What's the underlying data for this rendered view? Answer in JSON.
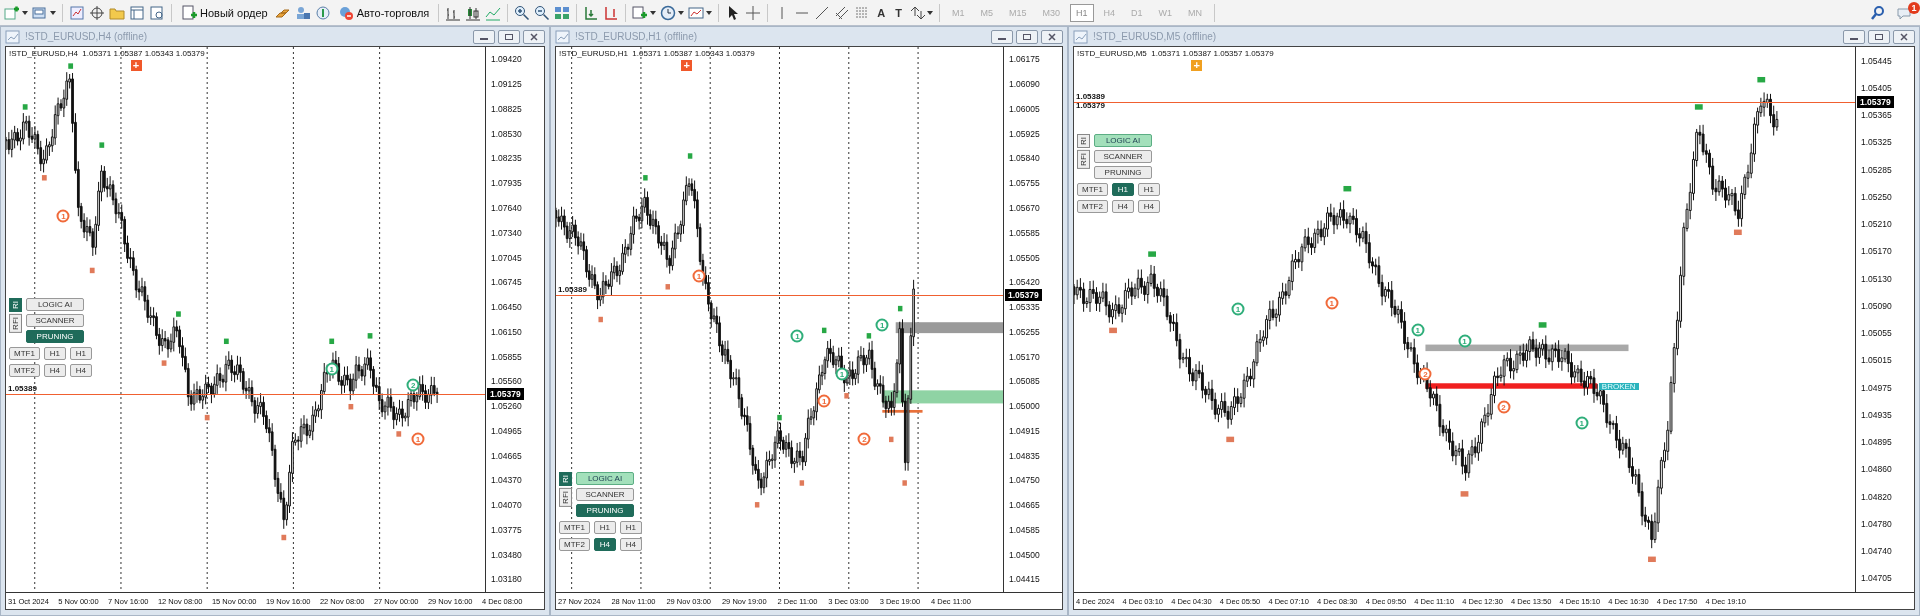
{
  "toolbar": {
    "new_order": "Новый ордер",
    "auto_trading": "Авто-торговля",
    "text_tool": "A",
    "label_tool": "T",
    "timeframes": [
      {
        "label": "M1",
        "selected": false
      },
      {
        "label": "M5",
        "selected": false
      },
      {
        "label": "M15",
        "selected": false
      },
      {
        "label": "M30",
        "selected": false
      },
      {
        "label": "H1",
        "selected": true
      },
      {
        "label": "H4",
        "selected": false
      },
      {
        "label": "D1",
        "selected": false
      },
      {
        "label": "W1",
        "selected": false
      },
      {
        "label": "MN",
        "selected": false
      }
    ],
    "notification_badge": "1"
  },
  "charts": [
    {
      "title": "!STD_EURUSD,H4 (offline)",
      "info": "!STD_EURUSD,H4  1.05371 1.05387 1.05343 1.05379",
      "plus": "+",
      "yticks": [
        "1.09420",
        "1.09125",
        "1.08825",
        "1.08530",
        "1.08235",
        "1.07935",
        "1.07640",
        "1.07340",
        "1.07045",
        "1.06745",
        "1.06450",
        "1.06150",
        "1.05855",
        "1.05560",
        "1.05260",
        "1.04965",
        "1.04665",
        "1.04370",
        "1.04070",
        "1.03775",
        "1.03480",
        "1.03180"
      ],
      "xticks": [
        "31 Oct 2024",
        "5 Nov 00:00",
        "7 Nov 16:00",
        "12 Nov 08:00",
        "15 Nov 00:00",
        "19 Nov 16:00",
        "22 Nov 08:00",
        "27 Nov 00:00",
        "29 Nov 16:00",
        "4 Dec 08:00"
      ],
      "price_tag": "1.05379",
      "line_labels": [
        "1.05389"
      ],
      "markers": [
        {
          "label": "1",
          "color": "#f06a3a"
        },
        {
          "label": "1",
          "color": "#2fae7a"
        },
        {
          "label": "2",
          "color": "#2fae7a"
        },
        {
          "label": "1",
          "color": "#f06a3a"
        }
      ],
      "indicator": {
        "tabs": [
          {
            "label": "RI",
            "selected": true
          },
          {
            "label": "RFI",
            "selected": false
          }
        ],
        "buttons": [
          {
            "label": "LOGIC AI",
            "selected": false,
            "highlighted": false
          },
          {
            "label": "SCANNER",
            "selected": false,
            "highlighted": false
          },
          {
            "label": "PRUNING",
            "selected": true,
            "highlighted": false
          }
        ],
        "mtf_rows": [
          {
            "buttons": [
              {
                "label": "MTF1",
                "selected": false
              },
              {
                "label": "H1",
                "selected": false
              },
              {
                "label": "H1",
                "selected": false
              }
            ]
          },
          {
            "buttons": [
              {
                "label": "MTF2",
                "selected": false
              },
              {
                "label": "H4",
                "selected": false
              },
              {
                "label": "H4",
                "selected": false
              }
            ]
          }
        ]
      }
    },
    {
      "title": "!STD_EURUSD,H1 (offline)",
      "info": "!STD_EURUSD,H1  1.05371 1.05387 1.05343 1.05379",
      "plus": "+",
      "yticks": [
        "1.06175",
        "1.06090",
        "1.06005",
        "1.05925",
        "1.05840",
        "1.05755",
        "1.05670",
        "1.05585",
        "1.05505",
        "1.05420",
        "1.05335",
        "1.05255",
        "1.05170",
        "1.05085",
        "1.05000",
        "1.04915",
        "1.04835",
        "1.04750",
        "1.04665",
        "1.04585",
        "1.04500",
        "1.04415"
      ],
      "xticks": [
        "27 Nov 2024",
        "28 Nov 11:00",
        "29 Nov 03:00",
        "29 Nov 19:00",
        "2 Dec 11:00",
        "3 Dec 03:00",
        "3 Dec 19:00",
        "4 Dec 11:00"
      ],
      "price_tag": "1.05379",
      "line_labels": [
        "1.05389"
      ],
      "markers": [
        {
          "label": "1",
          "color": "#f06a3a"
        },
        {
          "label": "1",
          "color": "#2fae7a"
        },
        {
          "label": "1",
          "color": "#f06a3a"
        },
        {
          "label": "1",
          "color": "#2fae7a"
        },
        {
          "label": "1",
          "color": "#2fae7a"
        },
        {
          "label": "2",
          "color": "#f06a3a"
        }
      ],
      "indicator": {
        "tabs": [
          {
            "label": "RI",
            "selected": true
          },
          {
            "label": "RFI",
            "selected": false
          }
        ],
        "buttons": [
          {
            "label": "LOGIC AI",
            "selected": false,
            "highlighted": true
          },
          {
            "label": "SCANNER",
            "selected": false,
            "highlighted": false
          },
          {
            "label": "PRUNING",
            "selected": true,
            "highlighted": false
          }
        ],
        "mtf_rows": [
          {
            "buttons": [
              {
                "label": "MTF1",
                "selected": false
              },
              {
                "label": "H1",
                "selected": false
              },
              {
                "label": "H1",
                "selected": false
              }
            ]
          },
          {
            "buttons": [
              {
                "label": "MTF2",
                "selected": false
              },
              {
                "label": "H4",
                "selected": true
              },
              {
                "label": "H4",
                "selected": false
              }
            ]
          }
        ]
      }
    },
    {
      "title": "!STD_EURUSD,M5 (offline)",
      "info": "!STD_EURUSD,M5  1.05371 1.05387 1.05357 1.05379",
      "plus": "+",
      "yticks": [
        "1.05445",
        "1.05405",
        "1.05365",
        "1.05325",
        "1.05285",
        "1.05250",
        "1.05210",
        "1.05170",
        "1.05130",
        "1.05090",
        "1.05055",
        "1.05015",
        "1.04975",
        "1.04935",
        "1.04895",
        "1.04860",
        "1.04820",
        "1.04780",
        "1.04740",
        "1.04705"
      ],
      "xticks": [
        "4 Dec 2024",
        "4 Dec 03:10",
        "4 Dec 04:30",
        "4 Dec 05:50",
        "4 Dec 07:10",
        "4 Dec 08:30",
        "4 Dec 09:50",
        "4 Dec 11:10",
        "4 Dec 12:30",
        "4 Dec 13:50",
        "4 Dec 15:10",
        "4 Dec 16:30",
        "4 Dec 17:50",
        "4 Dec 19:10"
      ],
      "price_tag": "1.05379",
      "line_labels": [
        "1.05389",
        "1.05379"
      ],
      "broken_label": "BROKEN",
      "markers": [
        {
          "label": "1",
          "color": "#2fae7a"
        },
        {
          "label": "1",
          "color": "#f06a3a"
        },
        {
          "label": "1",
          "color": "#2fae7a"
        },
        {
          "label": "1",
          "color": "#2fae7a"
        },
        {
          "label": "2",
          "color": "#f06a3a"
        },
        {
          "label": "2",
          "color": "#f06a3a"
        },
        {
          "label": "1",
          "color": "#2fae7a"
        }
      ],
      "indicator": {
        "tabs": [
          {
            "label": "RI",
            "selected": false
          },
          {
            "label": "RFI",
            "selected": false
          }
        ],
        "buttons": [
          {
            "label": "LOGIC AI",
            "selected": false,
            "highlighted": true
          },
          {
            "label": "SCANNER",
            "selected": false,
            "highlighted": false
          },
          {
            "label": "PRUNING",
            "selected": false,
            "highlighted": false
          }
        ],
        "mtf_rows": [
          {
            "buttons": [
              {
                "label": "MTF1",
                "selected": false
              },
              {
                "label": "H1",
                "selected": true
              },
              {
                "label": "H1",
                "selected": false
              }
            ]
          },
          {
            "buttons": [
              {
                "label": "MTF2",
                "selected": false
              },
              {
                "label": "H4",
                "selected": false
              },
              {
                "label": "H4",
                "selected": false
              }
            ]
          }
        ]
      }
    }
  ]
}
